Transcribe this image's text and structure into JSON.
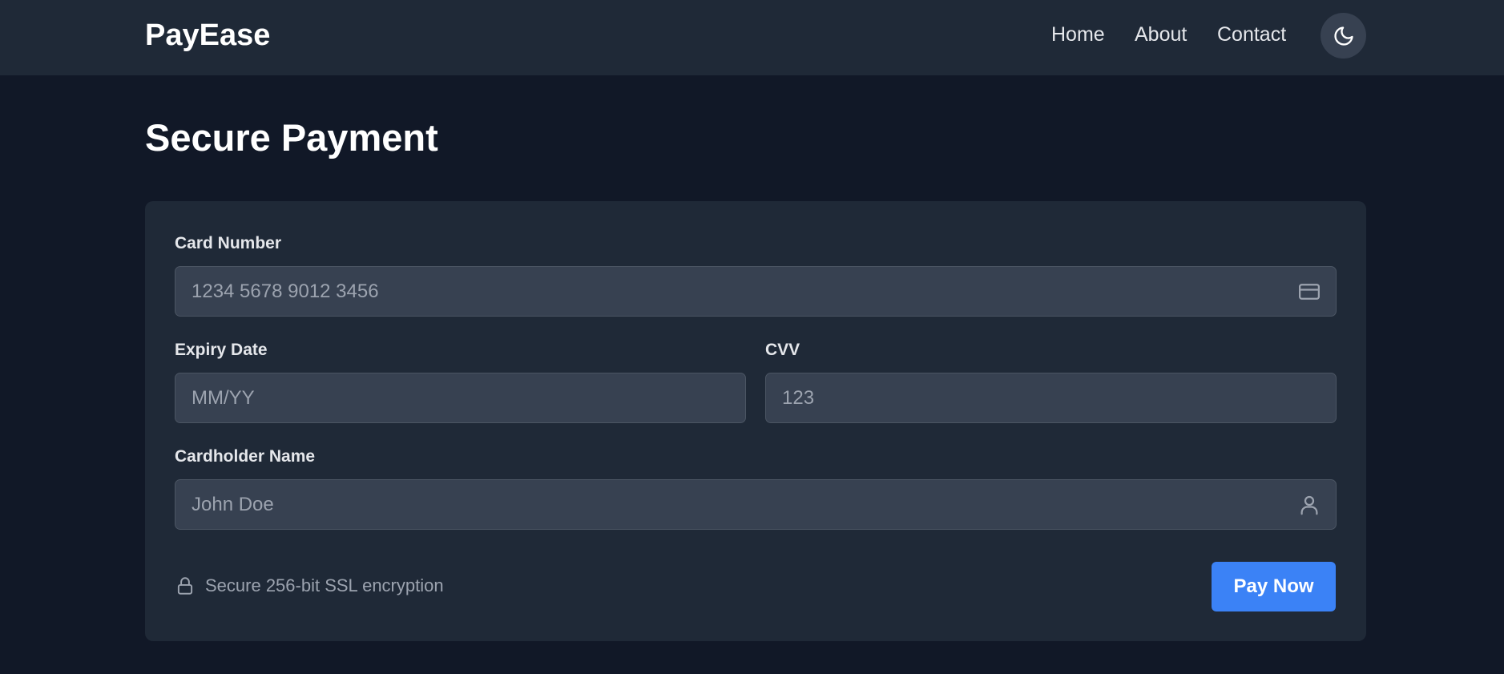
{
  "navbar": {
    "brand": "PayEase",
    "links": [
      {
        "label": "Home"
      },
      {
        "label": "About"
      },
      {
        "label": "Contact"
      }
    ],
    "theme_toggle_icon": "moon-icon"
  },
  "page": {
    "title": "Secure Payment"
  },
  "form": {
    "card_number": {
      "label": "Card Number",
      "value": "",
      "placeholder": "1234 5678 9012 3456",
      "icon": "credit-card-icon"
    },
    "expiry_date": {
      "label": "Expiry Date",
      "value": "",
      "placeholder": "MM/YY"
    },
    "cvv": {
      "label": "CVV",
      "value": "",
      "placeholder": "123"
    },
    "cardholder_name": {
      "label": "Cardholder Name",
      "value": "",
      "placeholder": "John Doe",
      "icon": "user-icon"
    },
    "ssl_note": {
      "icon": "lock-icon",
      "text": "Secure 256-bit SSL encryption"
    },
    "submit_label": "Pay Now"
  },
  "colors": {
    "background": "#111827",
    "surface": "#1f2937",
    "input": "#374151",
    "accent": "#3b82f6"
  }
}
